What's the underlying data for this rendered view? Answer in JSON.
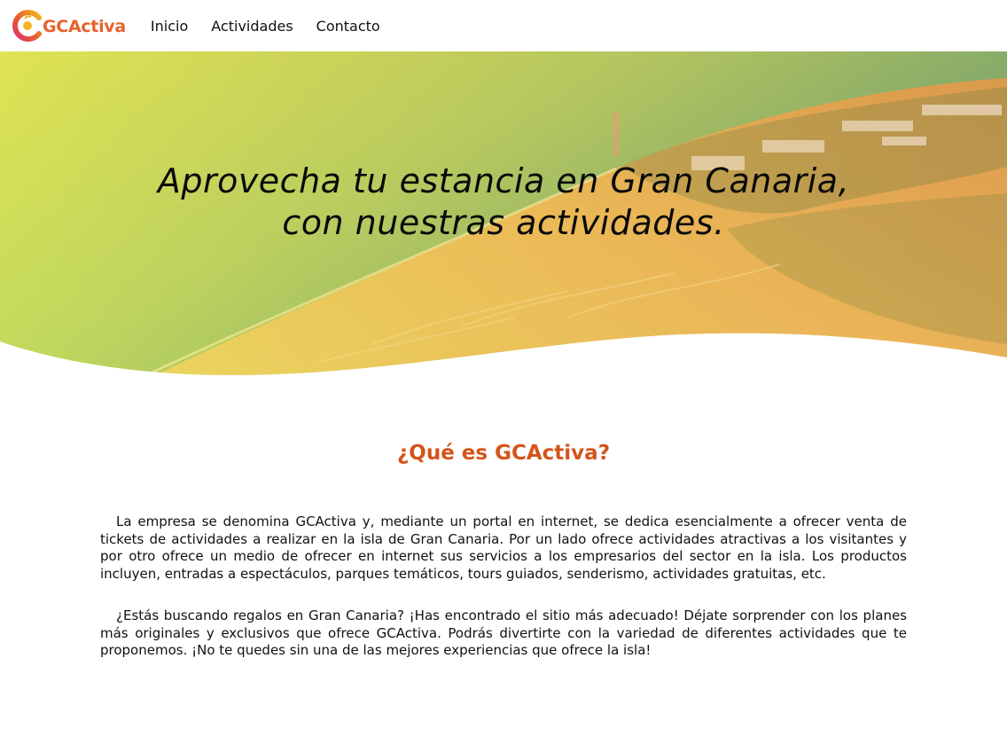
{
  "nav": {
    "logo_text": "GCActiva",
    "links": [
      "Inicio",
      "Actividades",
      "Contacto"
    ]
  },
  "hero": {
    "title_line1": "Aprovecha tu estancia en Gran Canaria,",
    "title_line2": "con nuestras actividades."
  },
  "about": {
    "heading": "¿Qué es GCActiva?",
    "paragraphs": [
      "La empresa se denomina GCActiva y, mediante un portal en internet, se dedica esencialmente a ofrecer venta de tickets de actividades a realizar en la isla de Gran Canaria. Por un lado ofrece actividades atractivas a los visitantes y por otro ofrece un medio de ofrecer en internet sus servicios a los empresarios del sector en la isla. Los productos incluyen, entradas a espectáculos, parques temáticos, tours guiados, senderismo, actividades gratuitas, etc.",
      "¿Estás buscando regalos en Gran Canaria? ¡Has encontrado el sitio más adecuado! Déjate sorprender con los planes más originales y exclusivos que ofrece GCActiva. Podrás divertirte con la variedad de diferentes actividades que te proponemos. ¡No te quedes sin una de las mejores experiencias que ofrece la isla!"
    ]
  },
  "colors": {
    "brand_orange": "#e8622a",
    "heading_orange": "#d4541a",
    "logo_red": "#e23a3a",
    "logo_yellow": "#f5b521"
  },
  "icons": {
    "logo": "gcactiva-logo-icon"
  }
}
